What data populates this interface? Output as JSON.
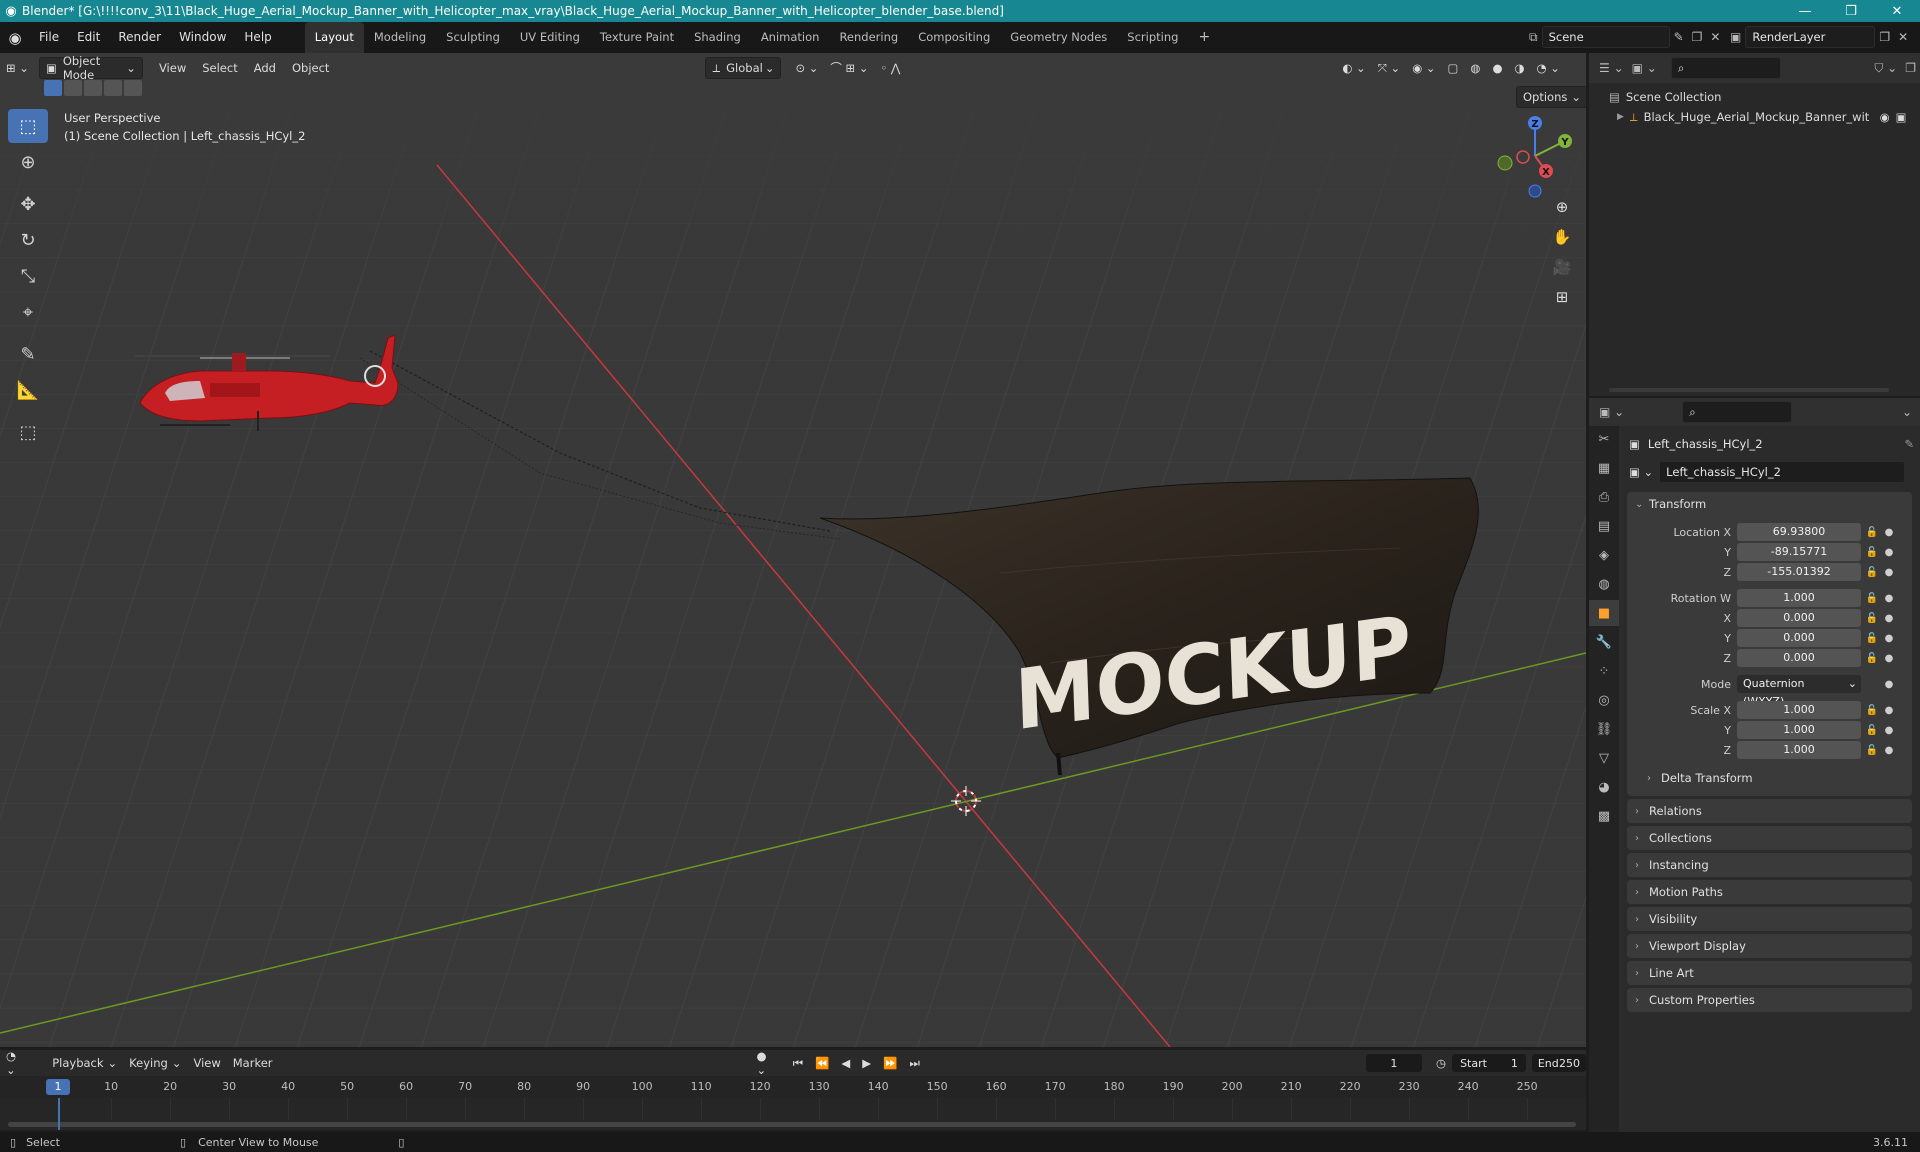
{
  "window": {
    "title": "Blender* [G:\\!!!!conv_3\\11\\Black_Huge_Aerial_Mockup_Banner_with_Helicopter_max_vray\\Black_Huge_Aerial_Mockup_Banner_with_Helicopter_blender_base.blend]",
    "minimize": "—",
    "maximize": "❐",
    "close": "✕"
  },
  "menu": [
    "File",
    "Edit",
    "Render",
    "Window",
    "Help"
  ],
  "workspaces": [
    "Layout",
    "Modeling",
    "Sculpting",
    "UV Editing",
    "Texture Paint",
    "Shading",
    "Animation",
    "Rendering",
    "Compositing",
    "Geometry Nodes",
    "Scripting"
  ],
  "workspace_add": "+",
  "scene": {
    "name": "Scene",
    "layer": "RenderLayer"
  },
  "viewport": {
    "mode": "Object Mode",
    "menus": [
      "View",
      "Select",
      "Add",
      "Object"
    ],
    "orientation": "Global",
    "options_label": "Options",
    "info_line1": "User Perspective",
    "info_line2": "(1) Scene Collection | Left_chassis_HCyl_2",
    "banner_text": "MOCKUP",
    "gizmo": {
      "x": "X",
      "y": "Y",
      "z": "Z"
    }
  },
  "outliner": {
    "search_placeholder": "",
    "root": "Scene Collection",
    "item": "Black_Huge_Aerial_Mockup_Banner_wit"
  },
  "properties": {
    "object_name": "Left_chassis_HCyl_2",
    "data_name": "Left_chassis_HCyl_2",
    "transform_title": "Transform",
    "location": {
      "label": "Location X",
      "x": "69.93800",
      "y": "-89.15771",
      "z": "-155.01392"
    },
    "rotation": {
      "label": "Rotation W",
      "w": "1.000",
      "x": "0.000",
      "y": "0.000",
      "z": "0.000"
    },
    "mode": {
      "label": "Mode",
      "value": "Quaternion (WXYZ)"
    },
    "scale": {
      "label": "Scale X",
      "x": "1.000",
      "y": "1.000",
      "z": "1.000"
    },
    "axis": {
      "y": "Y",
      "z": "Z",
      "x": "X"
    },
    "delta_transform": "Delta Transform",
    "panels": [
      "Relations",
      "Collections",
      "Instancing",
      "Motion Paths",
      "Visibility",
      "Viewport Display",
      "Line Art",
      "Custom Properties"
    ]
  },
  "timeline": {
    "menus": [
      "Playback",
      "Keying",
      "View",
      "Marker"
    ],
    "current_frame": "1",
    "start_label": "Start",
    "start": "1",
    "end_label": "End",
    "end": "250",
    "ticks": [
      "10",
      "20",
      "30",
      "40",
      "50",
      "60",
      "70",
      "80",
      "90",
      "100",
      "110",
      "120",
      "130",
      "140",
      "150",
      "160",
      "170",
      "180",
      "190",
      "200",
      "210",
      "220",
      "230",
      "240",
      "250"
    ],
    "playhead": "1"
  },
  "status": {
    "select": "Select",
    "center_view": "Center View to Mouse",
    "version": "3.6.11"
  },
  "colors": {
    "title_bar": "#178891",
    "active_tool": "#4772b3",
    "x_axis": "#c8383d",
    "y_axis": "#6a9a22",
    "helicopter": "#c51f24"
  }
}
